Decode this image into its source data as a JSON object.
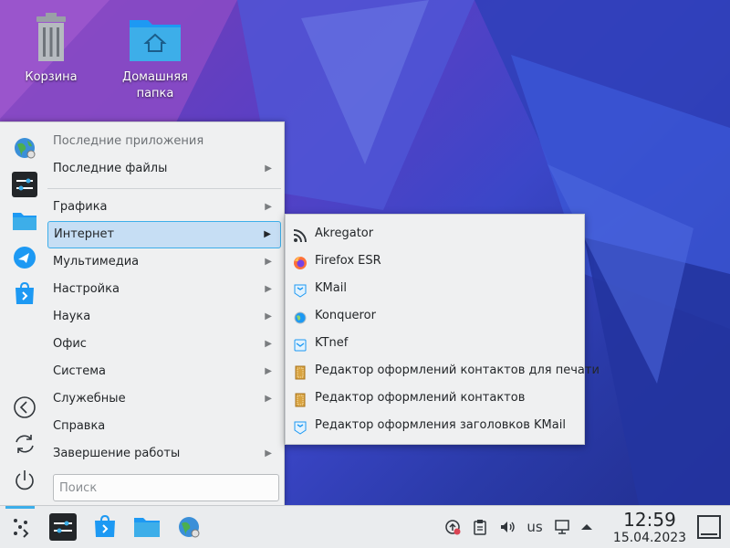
{
  "desktop": {
    "icons": [
      {
        "label": "Корзина",
        "icon": "trash-icon"
      },
      {
        "label": "Домашняя папка",
        "icon": "home-folder-icon"
      }
    ]
  },
  "launcher": {
    "favorites": [
      {
        "name": "globe-settings-icon"
      },
      {
        "name": "system-settings-icon"
      },
      {
        "name": "folder-icon"
      },
      {
        "name": "discover-icon"
      },
      {
        "name": "store-icon"
      }
    ],
    "system_actions": [
      {
        "name": "logout-icon"
      },
      {
        "name": "restart-icon"
      },
      {
        "name": "shutdown-icon"
      }
    ],
    "items": [
      {
        "label": "Последние приложения"
      },
      {
        "label": "Последние файлы"
      },
      {
        "label": "Графика"
      },
      {
        "label": "Интернет"
      },
      {
        "label": "Мультимедиа"
      },
      {
        "label": "Настройка"
      },
      {
        "label": "Наука"
      },
      {
        "label": "Офис"
      },
      {
        "label": "Система"
      },
      {
        "label": "Служебные"
      },
      {
        "label": "Справка"
      },
      {
        "label": "Завершение работы"
      }
    ],
    "search_placeholder": "Поиск"
  },
  "submenu": {
    "items": [
      {
        "label": "Akregator",
        "icon": "rss-icon"
      },
      {
        "label": "Firefox ESR",
        "icon": "firefox-icon"
      },
      {
        "label": "KMail",
        "icon": "kmail-icon"
      },
      {
        "label": "Konqueror",
        "icon": "konqueror-icon"
      },
      {
        "label": "KTnef",
        "icon": "ktnef-icon"
      },
      {
        "label": "Редактор оформлений контактов для печати",
        "icon": "contact-print-theme-icon"
      },
      {
        "label": "Редактор оформлений контактов",
        "icon": "contact-theme-icon"
      },
      {
        "label": "Редактор оформления заголовков KMail",
        "icon": "kmail-header-theme-icon"
      }
    ]
  },
  "taskbar": {
    "keyboard_layout": "us",
    "time": "12:59",
    "date": "15.04.2023"
  },
  "colors": {
    "accent": "#3daee9",
    "selection": "#c6def4",
    "menu_bg": "#eff0f1"
  }
}
